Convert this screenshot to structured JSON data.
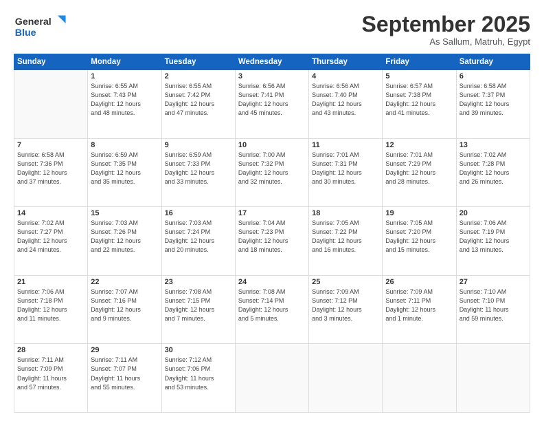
{
  "header": {
    "logo_general": "General",
    "logo_blue": "Blue",
    "month": "September 2025",
    "location": "As Sallum, Matruh, Egypt"
  },
  "weekdays": [
    "Sunday",
    "Monday",
    "Tuesday",
    "Wednesday",
    "Thursday",
    "Friday",
    "Saturday"
  ],
  "weeks": [
    [
      {
        "day": "",
        "info": ""
      },
      {
        "day": "1",
        "info": "Sunrise: 6:55 AM\nSunset: 7:43 PM\nDaylight: 12 hours\nand 48 minutes."
      },
      {
        "day": "2",
        "info": "Sunrise: 6:55 AM\nSunset: 7:42 PM\nDaylight: 12 hours\nand 47 minutes."
      },
      {
        "day": "3",
        "info": "Sunrise: 6:56 AM\nSunset: 7:41 PM\nDaylight: 12 hours\nand 45 minutes."
      },
      {
        "day": "4",
        "info": "Sunrise: 6:56 AM\nSunset: 7:40 PM\nDaylight: 12 hours\nand 43 minutes."
      },
      {
        "day": "5",
        "info": "Sunrise: 6:57 AM\nSunset: 7:38 PM\nDaylight: 12 hours\nand 41 minutes."
      },
      {
        "day": "6",
        "info": "Sunrise: 6:58 AM\nSunset: 7:37 PM\nDaylight: 12 hours\nand 39 minutes."
      }
    ],
    [
      {
        "day": "7",
        "info": "Sunrise: 6:58 AM\nSunset: 7:36 PM\nDaylight: 12 hours\nand 37 minutes."
      },
      {
        "day": "8",
        "info": "Sunrise: 6:59 AM\nSunset: 7:35 PM\nDaylight: 12 hours\nand 35 minutes."
      },
      {
        "day": "9",
        "info": "Sunrise: 6:59 AM\nSunset: 7:33 PM\nDaylight: 12 hours\nand 33 minutes."
      },
      {
        "day": "10",
        "info": "Sunrise: 7:00 AM\nSunset: 7:32 PM\nDaylight: 12 hours\nand 32 minutes."
      },
      {
        "day": "11",
        "info": "Sunrise: 7:01 AM\nSunset: 7:31 PM\nDaylight: 12 hours\nand 30 minutes."
      },
      {
        "day": "12",
        "info": "Sunrise: 7:01 AM\nSunset: 7:29 PM\nDaylight: 12 hours\nand 28 minutes."
      },
      {
        "day": "13",
        "info": "Sunrise: 7:02 AM\nSunset: 7:28 PM\nDaylight: 12 hours\nand 26 minutes."
      }
    ],
    [
      {
        "day": "14",
        "info": "Sunrise: 7:02 AM\nSunset: 7:27 PM\nDaylight: 12 hours\nand 24 minutes."
      },
      {
        "day": "15",
        "info": "Sunrise: 7:03 AM\nSunset: 7:26 PM\nDaylight: 12 hours\nand 22 minutes."
      },
      {
        "day": "16",
        "info": "Sunrise: 7:03 AM\nSunset: 7:24 PM\nDaylight: 12 hours\nand 20 minutes."
      },
      {
        "day": "17",
        "info": "Sunrise: 7:04 AM\nSunset: 7:23 PM\nDaylight: 12 hours\nand 18 minutes."
      },
      {
        "day": "18",
        "info": "Sunrise: 7:05 AM\nSunset: 7:22 PM\nDaylight: 12 hours\nand 16 minutes."
      },
      {
        "day": "19",
        "info": "Sunrise: 7:05 AM\nSunset: 7:20 PM\nDaylight: 12 hours\nand 15 minutes."
      },
      {
        "day": "20",
        "info": "Sunrise: 7:06 AM\nSunset: 7:19 PM\nDaylight: 12 hours\nand 13 minutes."
      }
    ],
    [
      {
        "day": "21",
        "info": "Sunrise: 7:06 AM\nSunset: 7:18 PM\nDaylight: 12 hours\nand 11 minutes."
      },
      {
        "day": "22",
        "info": "Sunrise: 7:07 AM\nSunset: 7:16 PM\nDaylight: 12 hours\nand 9 minutes."
      },
      {
        "day": "23",
        "info": "Sunrise: 7:08 AM\nSunset: 7:15 PM\nDaylight: 12 hours\nand 7 minutes."
      },
      {
        "day": "24",
        "info": "Sunrise: 7:08 AM\nSunset: 7:14 PM\nDaylight: 12 hours\nand 5 minutes."
      },
      {
        "day": "25",
        "info": "Sunrise: 7:09 AM\nSunset: 7:12 PM\nDaylight: 12 hours\nand 3 minutes."
      },
      {
        "day": "26",
        "info": "Sunrise: 7:09 AM\nSunset: 7:11 PM\nDaylight: 12 hours\nand 1 minute."
      },
      {
        "day": "27",
        "info": "Sunrise: 7:10 AM\nSunset: 7:10 PM\nDaylight: 11 hours\nand 59 minutes."
      }
    ],
    [
      {
        "day": "28",
        "info": "Sunrise: 7:11 AM\nSunset: 7:09 PM\nDaylight: 11 hours\nand 57 minutes."
      },
      {
        "day": "29",
        "info": "Sunrise: 7:11 AM\nSunset: 7:07 PM\nDaylight: 11 hours\nand 55 minutes."
      },
      {
        "day": "30",
        "info": "Sunrise: 7:12 AM\nSunset: 7:06 PM\nDaylight: 11 hours\nand 53 minutes."
      },
      {
        "day": "",
        "info": ""
      },
      {
        "day": "",
        "info": ""
      },
      {
        "day": "",
        "info": ""
      },
      {
        "day": "",
        "info": ""
      }
    ]
  ]
}
